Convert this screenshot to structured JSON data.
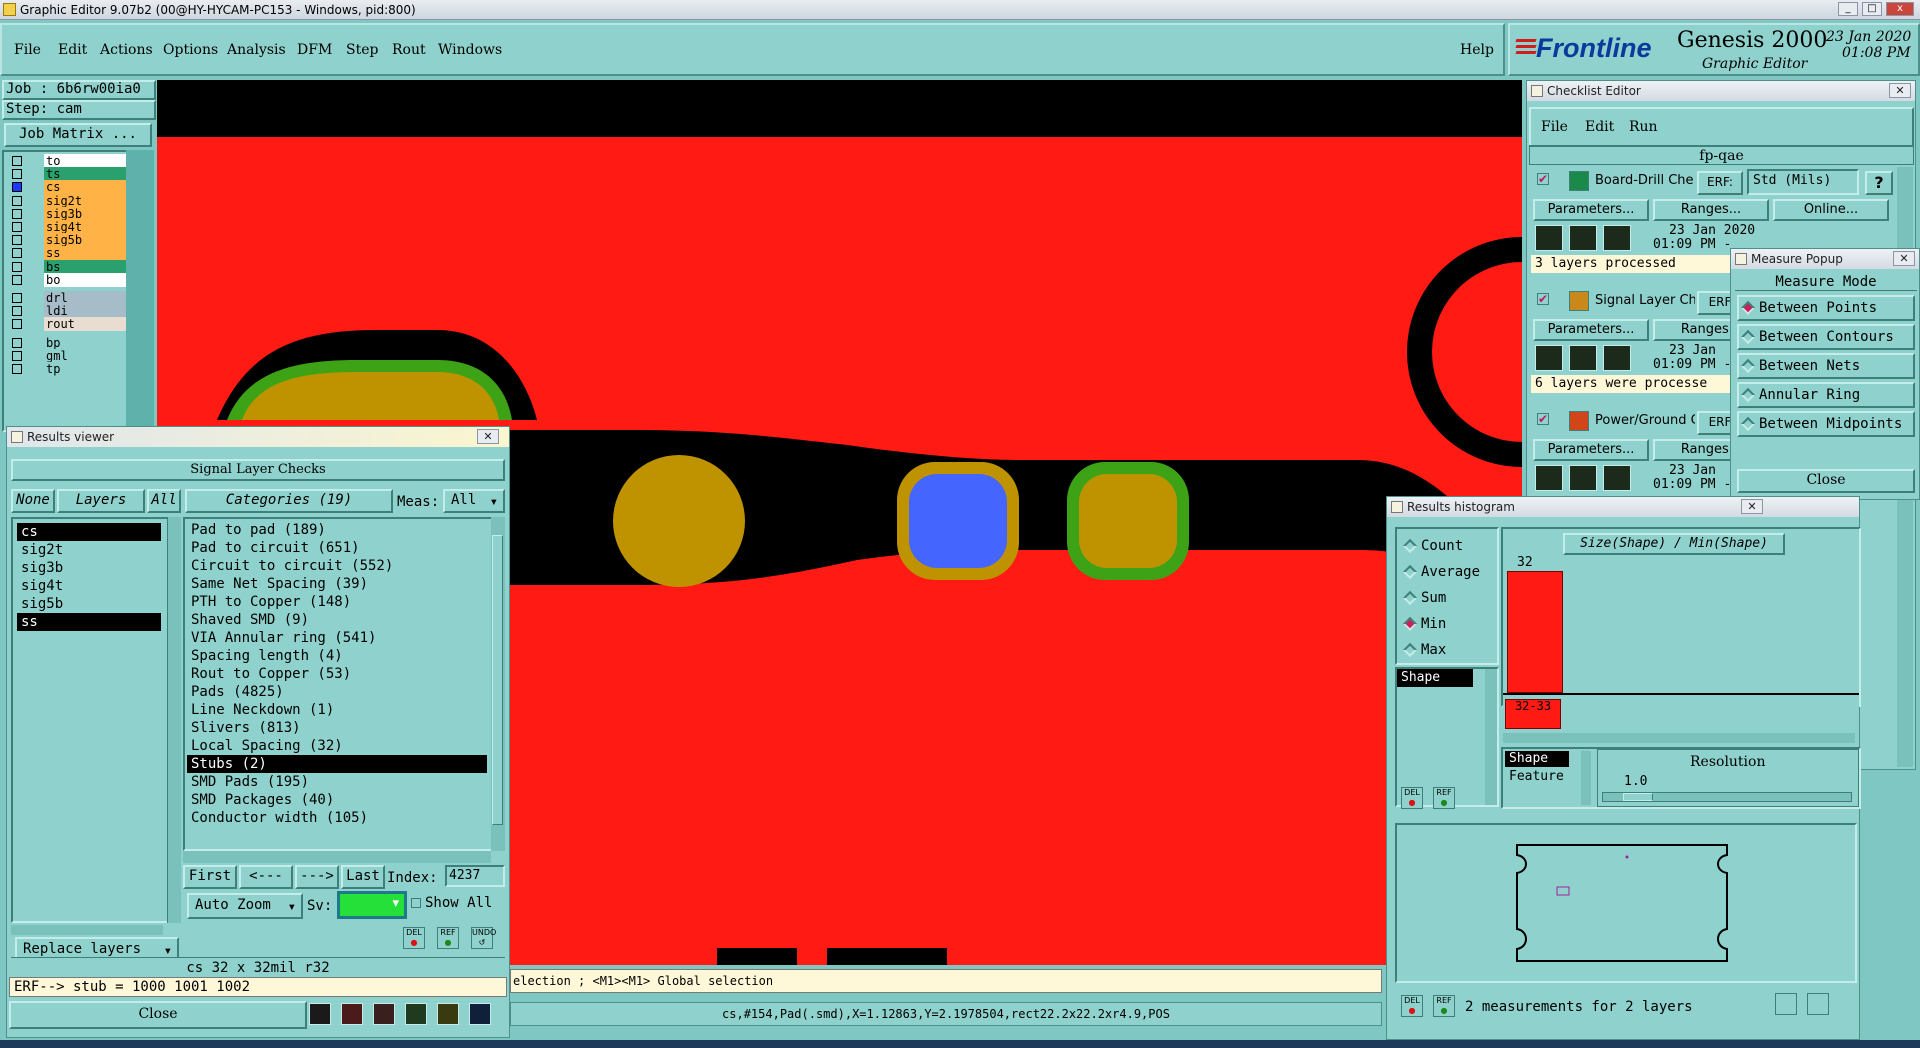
{
  "window": {
    "title": "Graphic Editor 9.07b2 (00@HY-HYCAM-PC153 - Windows, pid:800)",
    "controls": [
      "_",
      "□",
      "x"
    ]
  },
  "menu": {
    "items": [
      "File",
      "Edit",
      "Actions",
      "Options",
      "Analysis",
      "DFM",
      "Step",
      "Rout",
      "Windows"
    ],
    "help": "Help"
  },
  "brand": {
    "logo": "Frontline",
    "product": "Genesis 2000",
    "subtitle": "Graphic Editor",
    "date": "23 Jan 2020",
    "time": "01:08 PM"
  },
  "job": {
    "job_label": "Job : 6b6rw00ia0",
    "step_label": "Step: cam",
    "matrix_button": "Job Matrix ..."
  },
  "layers": [
    {
      "name": "to",
      "color": "#ffffff"
    },
    {
      "name": "ts",
      "color": "#29a06e"
    },
    {
      "name": "cs",
      "color": "#ffb347"
    },
    {
      "name": "sig2t",
      "color": "#ffb347"
    },
    {
      "name": "sig3b",
      "color": "#ffb347"
    },
    {
      "name": "sig4t",
      "color": "#ffb347"
    },
    {
      "name": "sig5b",
      "color": "#ffb347"
    },
    {
      "name": "ss",
      "color": "#ffb347"
    },
    {
      "name": "bs",
      "color": "#29a06e"
    },
    {
      "name": "bo",
      "color": "#ffffff"
    },
    {
      "name": "drl",
      "color": "#a6bcc8"
    },
    {
      "name": "ldi",
      "color": "#a6bcc8"
    },
    {
      "name": "rout",
      "color": "#e8ddd0"
    },
    {
      "name": "bp",
      "color": "#8fd1cc"
    },
    {
      "name": "gml",
      "color": "#8fd1cc"
    },
    {
      "name": "tp",
      "color": "#8fd1cc"
    }
  ],
  "results_viewer": {
    "title": "Results viewer",
    "header": "Signal Layer Checks",
    "none_label": "None",
    "layers_label": "Layers",
    "all_label": "All",
    "layer_list": [
      "cs",
      "sig2t",
      "sig3b",
      "sig4t",
      "sig5b",
      "ss"
    ],
    "categories_label": "Categories (19)",
    "meas_label": "Meas:",
    "meas_value": "All",
    "categories": [
      "Pad to pad (189)",
      "Pad to circuit (651)",
      "Circuit to circuit (552)",
      "Same Net Spacing (39)",
      "PTH to Copper (148)",
      "Shaved SMD (9)",
      "VIA Annular ring (541)",
      "Spacing length (4)",
      "Rout to Copper (53)",
      "Pads (4825)",
      "Line Neckdown (1)",
      "Slivers (813)",
      "Local Spacing (32)",
      "Stubs (2)",
      "SMD Pads (195)",
      "SMD Packages (40)",
      "Conductor width (105)"
    ],
    "first": "First",
    "prev": "<---",
    "next": "--->",
    "last": "Last",
    "index_label": "Index:",
    "index_value": "4237",
    "auto_zoom": "Auto Zoom",
    "sv_label": "Sv:",
    "show_all": "Show All",
    "replace_layers": "Replace layers",
    "info_line": "cs 32 x 32mil  r32",
    "erf_line": "ERF--> stub = 1000 1001 1002",
    "close": "Close",
    "del": "DEL",
    "ref": "REF",
    "undo": "UNDO"
  },
  "checklist": {
    "title": "Checklist Editor",
    "menu": [
      "File",
      "Edit",
      "Run"
    ],
    "name": "fp-qae",
    "erf_label": "ERF:",
    "erf_value": "Std (Mils)",
    "checks": [
      {
        "name": "Board-Drill Che",
        "date": "23 Jan 2020",
        "time": "01:09 PM -",
        "status": "3 layers processed"
      },
      {
        "name": "Signal Layer Ch",
        "date": "23 Jan",
        "time": "01:09 PM -",
        "status": "6 layers were processe"
      },
      {
        "name": "Power/Ground C",
        "date": "23 Jan",
        "time": "01:09 PM -",
        "status": ""
      }
    ],
    "parameters": "Parameters...",
    "ranges": "Ranges...",
    "online": "Online...",
    "erf_short": "ERF"
  },
  "measure": {
    "title": "Measure Popup",
    "header": "Measure Mode",
    "modes": [
      "Between Points",
      "Between Contours",
      "Between Nets",
      "Annular Ring",
      "Between Midpoints"
    ],
    "selected": "Between Points",
    "close": "Close"
  },
  "histogram": {
    "title": "Results histogram",
    "stats": [
      "Count",
      "Average",
      "Sum",
      "Min",
      "Max"
    ],
    "selected_stat": "Min",
    "left_list": [
      "Shape"
    ],
    "chart_title": "Size(Shape) / Min(Shape)",
    "bar_value": "32",
    "bin_label": "32-33",
    "bar_fraction": 1.0,
    "type_list": [
      "Shape",
      "Feature"
    ],
    "resolution_label": "Resolution",
    "resolution_value": "1.0",
    "summary": "2 measurements for 2 layers",
    "del": "DEL",
    "ref": "REF"
  },
  "status": {
    "line1": "election ; <M1><M1> Global selection",
    "line2": "cs,#154,Pad(.smd),X=1.12863,Y=2.1978504,rect22.2x22.2xr4.9,POS"
  },
  "colors": {
    "copper": "#ff1a14",
    "pad": "#bf9300",
    "mask": "#3ea216",
    "selected_pad": "#4466ff",
    "ui": "#8fd1cc"
  }
}
